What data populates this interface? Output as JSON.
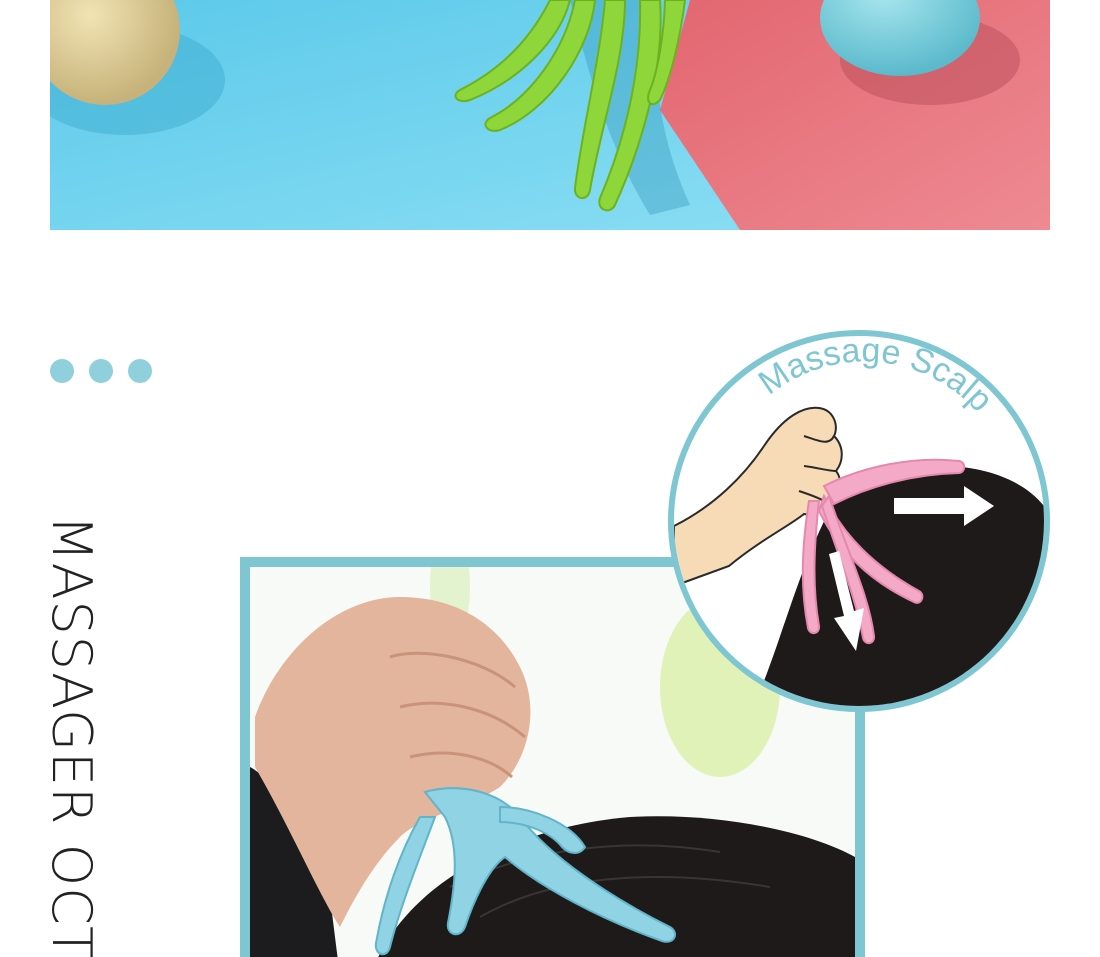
{
  "section": {
    "dots_count": 3,
    "vertical_title": "MASSAGER OCT"
  },
  "illustration": {
    "caption": "Massage Scalp"
  },
  "colors": {
    "accent": "#7ec6d2",
    "dot": "#8fd0dc",
    "banner_blue": "#7fd6ee",
    "banner_pink": "#e8717c",
    "massager_green": "#8fd63a",
    "massager_blue": "#8fd3e4",
    "illus_pink": "#f4a9c6",
    "hair": "#1e1a1a"
  }
}
